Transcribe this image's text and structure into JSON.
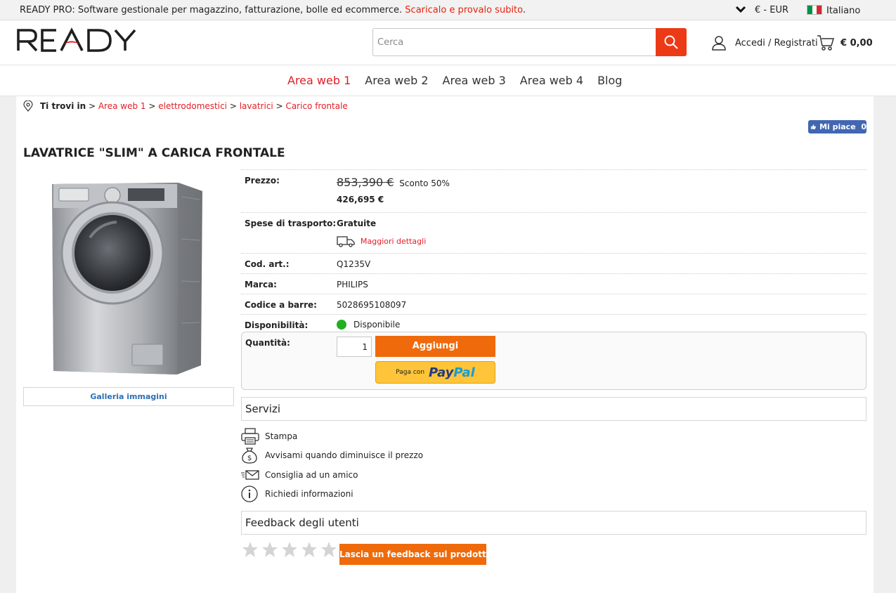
{
  "topbar": {
    "promo_text": "READY PRO: Software gestionale per magazzino, fatturazione, bolle ed ecommerce.",
    "promo_link": "Scaricalo e provalo subito",
    "currency": "€ - EUR",
    "language": "Italiano",
    "flag_colors": [
      "#009246",
      "#ffffff",
      "#ce2b37"
    ]
  },
  "header": {
    "logo_text": "READY",
    "search_placeholder": "Cerca",
    "login_label": "Accedi / Registrati",
    "cart_total": "€ 0,00"
  },
  "nav": {
    "items": [
      {
        "label": "Area web 1",
        "active": true
      },
      {
        "label": "Area web 2",
        "active": false
      },
      {
        "label": "Area web 3",
        "active": false
      },
      {
        "label": "Area web 4",
        "active": false
      },
      {
        "label": "Blog",
        "active": false
      }
    ]
  },
  "breadcrumb": {
    "prefix": "Ti trovi in",
    "sep": " > ",
    "items": [
      "Area web 1",
      "elettrodomestici",
      "lavatrici",
      "Carico frontale"
    ]
  },
  "facebook": {
    "label": "Mi piace",
    "count": "0"
  },
  "product": {
    "title": "LAVATRICE \"SLIM\" A CARICA FRONTALE",
    "gallery_label": "Galleria immagini",
    "price_label": "Prezzo:",
    "old_price": "853,390 €",
    "discount": "Sconto 50%",
    "new_price": "426,695 €",
    "shipping_label": "Spese di trasporto:",
    "shipping_value": "Gratuite",
    "shipping_details": "Maggiori dettagli",
    "code_label": "Cod. art.:",
    "code_value": "Q1235V",
    "brand_label": "Marca:",
    "brand_value": "PHILIPS",
    "barcode_label": "Codice a barre:",
    "barcode_value": "5028695108097",
    "availability_label": "Disponibilità:",
    "availability_value": "Disponibile",
    "quantity_label": "Quantità:",
    "quantity_value": "1",
    "add_button": "Aggiungi",
    "paypal_prefix": "Paga con",
    "paypal_brand_1": "Pay",
    "paypal_brand_2": "Pal"
  },
  "services": {
    "title": "Servizi",
    "items": [
      "Stampa",
      "Avvisami quando diminuisce il prezzo",
      "Consiglia ad un amico",
      "Richiedi informazioni"
    ]
  },
  "feedback": {
    "title": "Feedback degli utenti",
    "rating": 0,
    "max_rating": 5,
    "button": "Lascia un feedback sul prodotto"
  },
  "colors": {
    "accent_red": "#e21d24",
    "search_button": "#ec3a16",
    "orange_button": "#ef6a0b",
    "price_green": "#1b9e1b",
    "paypal_yellow": "#ffc439"
  }
}
